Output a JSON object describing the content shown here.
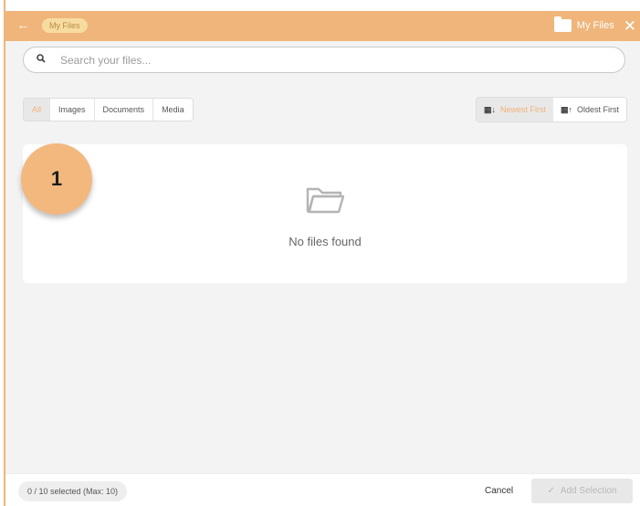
{
  "header": {
    "back_icon": "arrow-left-icon",
    "breadcrumb_chip": "My Files",
    "title": "My Files",
    "folder_icon": "folder-icon",
    "close_icon": "close-icon"
  },
  "search": {
    "placeholder": "Search your files...",
    "value": "",
    "icon": "search-icon"
  },
  "filters": [
    {
      "label": "All",
      "active": true
    },
    {
      "label": "Images",
      "active": false
    },
    {
      "label": "Documents",
      "active": false
    },
    {
      "label": "Media",
      "active": false
    }
  ],
  "sort": [
    {
      "label": "Newest First",
      "active": true,
      "icon": "sort-desc-icon"
    },
    {
      "label": "Oldest First",
      "active": false,
      "icon": "sort-asc-icon"
    }
  ],
  "empty_state": {
    "icon": "folder-open-icon",
    "message": "No files found"
  },
  "annotation_badge": "1",
  "footer": {
    "selection_count": "0 / 10 selected (Max: 10)",
    "cancel_label": "Cancel",
    "add_label": "Add Selection",
    "add_icon": "check-icon"
  },
  "colors": {
    "accent": "#efb57a",
    "badge": "#f2b87e",
    "panel_bg": "#f3f3f3"
  }
}
